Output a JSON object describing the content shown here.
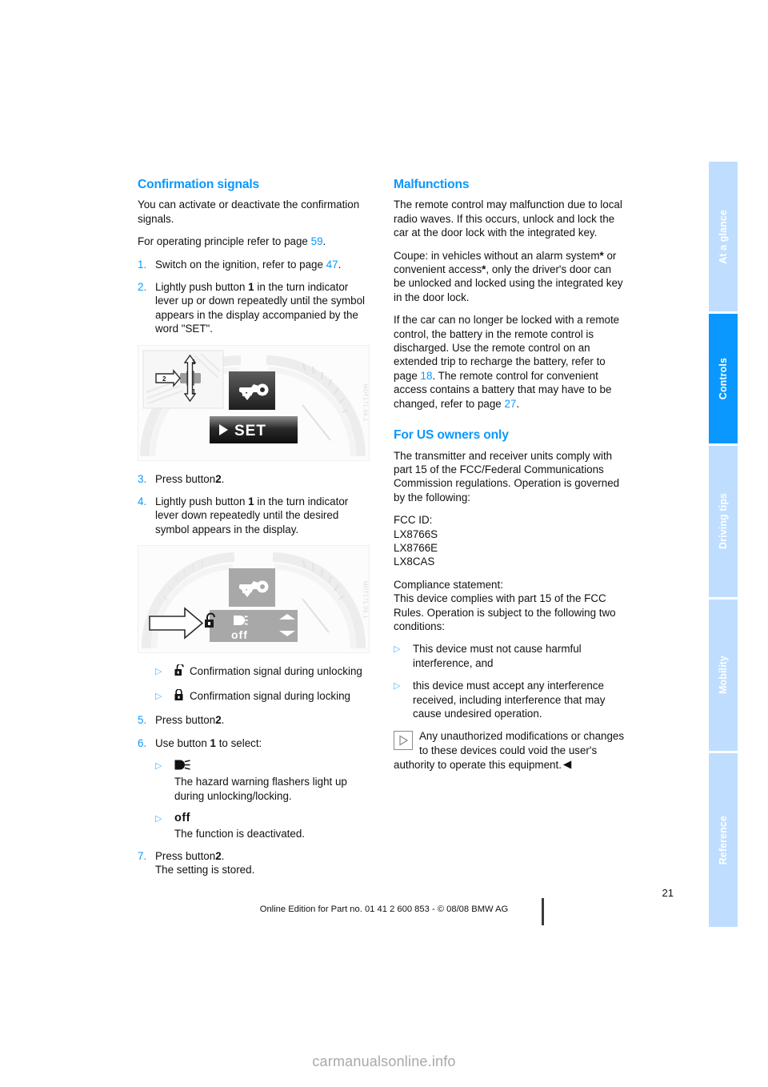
{
  "document": {
    "page_number": "21",
    "footer_line": "Online Edition for Part no. 01 41 2 600 853 - © 08/08 BMW AG",
    "watermark": "carmanualsonline.info",
    "accent_color": "#0a98fe",
    "tab_inactive_color": "#bfdeff"
  },
  "tabs": [
    {
      "label": "At a glance",
      "active": false
    },
    {
      "label": "Controls",
      "active": true
    },
    {
      "label": "Driving tips",
      "active": false
    },
    {
      "label": "Mobility",
      "active": false
    },
    {
      "label": "Reference",
      "active": false
    }
  ],
  "left_column": {
    "heading": "Confirmation signals",
    "intro": "You can activate or deactivate the confirmation signals.",
    "operating_principle_pre": "For operating principle refer to page",
    "operating_principle_ref": "59",
    "operating_principle_post": ".",
    "steps": [
      {
        "num": "1.",
        "text_pre": "Switch on the ignition, refer to page",
        "ref": "47",
        "text_post": "."
      },
      {
        "num": "2.",
        "text_a": "Lightly push button",
        "bold": "1",
        "text_b": "in the turn indicator lever up or down repeatedly until the symbol appears in the display accompanied by the word \"SET\"."
      },
      {
        "num": "3.",
        "text_a": "Press button",
        "bold": "2",
        "text_b": "."
      },
      {
        "num": "4.",
        "text_a": "Lightly push button",
        "bold": "1",
        "text_b": "in the turn indicator lever down repeatedly until the desired symbol appears in the display."
      },
      {
        "num": "5.",
        "text_a": "Press button",
        "bold": "2",
        "text_b": "."
      },
      {
        "num": "6.",
        "text_a": "Use button",
        "bold": "1",
        "text_b": "to select:"
      },
      {
        "num": "7.",
        "text_a": "Press button",
        "bold": "2",
        "text_b": ".",
        "sub": "The setting is stored."
      }
    ],
    "figure1": {
      "caption_code": "MOT171.09.1",
      "display_word": "SET",
      "callout_1": "1",
      "callout_2": "2",
      "symbol": "key-with-checkmark"
    },
    "figure2": {
      "caption_code": "MOT171.09.1",
      "display_word": "off",
      "symbol": "key-with-checkmark",
      "unlock_symbol": "open-padlock",
      "flasher_symbol": "hazard-flasher"
    },
    "signal_bullets": [
      {
        "icon": "open-padlock-icon",
        "label": "Confirmation signal during unlocking"
      },
      {
        "icon": "closed-padlock-icon",
        "label": "Confirmation signal during locking"
      }
    ],
    "select_options": [
      {
        "icon": "hazard-flasher-icon",
        "icon_text": "",
        "description": "The hazard warning flashers light up during unlocking/locking."
      },
      {
        "icon": "off-text",
        "icon_text": "off",
        "description": "The function is deactivated."
      }
    ]
  },
  "right_column": {
    "heading_malfunctions": "Malfunctions",
    "para_1": "The remote control may malfunction due to local radio waves. If this occurs, unlock and lock the car at the door lock with the integrated key.",
    "para_2_a": "Coupe: in vehicles without an alarm system",
    "para_2_star1": "*",
    "para_2_b": " or convenient access",
    "para_2_star2": "*",
    "para_2_c": ", only the driver's door can be unlocked and locked using the integrated key in the door lock.",
    "para_3_a": "If the car can no longer be locked with a remote control, the battery in the remote control is discharged. Use the remote control on an extended trip to recharge the battery, refer to page",
    "para_3_ref1": "18",
    "para_3_b": ". The remote control for convenient access contains a battery that may have to be changed, refer to page",
    "para_3_ref2": "27",
    "para_3_c": ".",
    "heading_us": "For US owners only",
    "para_4": "The transmitter and receiver units comply with part 15 of the FCC/Federal Communications Commission regulations. Operation is governed by the following:",
    "fcc_label": "FCC ID:",
    "fcc_ids": [
      "LX8766S",
      "LX8766E",
      "LX8CAS"
    ],
    "compliance_label": "Compliance statement:",
    "compliance_text": "This device complies with part 15 of the FCC Rules. Operation is subject to the following two conditions:",
    "conditions": [
      "This device must not cause harmful interference, and",
      "this device must accept any interference received, including interference that may cause undesired operation."
    ],
    "note": {
      "icon": "triangle-note-icon",
      "text": "Any unauthorized modifications or changes to these devices could void the user's authority to operate this equipment.",
      "endmark": "◀"
    }
  }
}
